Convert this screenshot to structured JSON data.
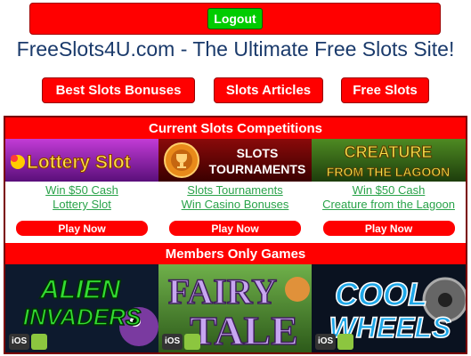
{
  "topbar": {
    "logout_label": "Logout"
  },
  "site_title": "FreeSlots4U.com - The Ultimate Free Slots Site!",
  "nav": [
    {
      "label": "Best Slots Bonuses"
    },
    {
      "label": "Slots Articles"
    },
    {
      "label": "Free Slots"
    }
  ],
  "competitions": {
    "heading": "Current Slots Competitions",
    "items": [
      {
        "banner_text": "Lottery Slot",
        "line1": "Win $50 Cash",
        "line2": "Lottery Slot",
        "play_label": "Play Now"
      },
      {
        "banner_line1": "SLOTS",
        "banner_line2": "TOURNAMENTS",
        "line1": "Slots Tournaments",
        "line2": "Win Casino Bonuses",
        "play_label": "Play Now"
      },
      {
        "banner_line1": "CREATURE",
        "banner_line2": "FROM THE LAGOON",
        "line1": "Win $50 Cash",
        "line2": "Creature from the Lagoon",
        "play_label": "Play Now"
      }
    ]
  },
  "members": {
    "heading": "Members Only Games",
    "games": [
      {
        "line1": "ALIEN",
        "line2": "INVADERS",
        "platform": "iOS"
      },
      {
        "line1": "FAIRY",
        "line2": "TALE",
        "platform": "iOS"
      },
      {
        "line1": "COOL",
        "line2": "WHEELS",
        "platform": "iOS"
      }
    ]
  },
  "colors": {
    "brand_red": "#ff0000",
    "logout_green": "#00cc00",
    "title_blue": "#1a3a6b",
    "link_green": "#2aa34a"
  }
}
